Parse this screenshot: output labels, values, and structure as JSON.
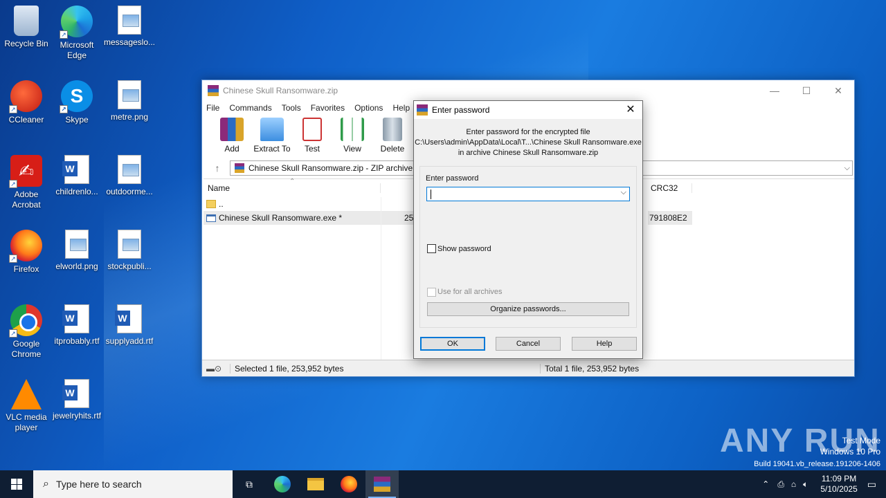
{
  "desktop": {
    "icons": [
      {
        "label": "Recycle Bin"
      },
      {
        "label": "Microsoft Edge"
      },
      {
        "label": "messageslo..."
      },
      {
        "label": "CCleaner"
      },
      {
        "label": "Skype"
      },
      {
        "label": "metre.png"
      },
      {
        "label": "Adobe Acrobat"
      },
      {
        "label": "childrenlo..."
      },
      {
        "label": "outdoorme..."
      },
      {
        "label": "Firefox"
      },
      {
        "label": "elworld.png"
      },
      {
        "label": "stockpubli..."
      },
      {
        "label": "Google Chrome"
      },
      {
        "label": "itprobably.rtf"
      },
      {
        "label": "supplyadd.rtf"
      },
      {
        "label": "VLC media player"
      },
      {
        "label": "jewelryhits.rtf"
      }
    ]
  },
  "winrar": {
    "title": "Chinese Skull Ransomware.zip",
    "menu": [
      "File",
      "Commands",
      "Tools",
      "Favorites",
      "Options",
      "Help"
    ],
    "toolbar": [
      "Add",
      "Extract To",
      "Test",
      "View",
      "Delete"
    ],
    "address": "Chinese Skull Ransomware.zip - ZIP archive",
    "columns": {
      "name": "Name",
      "crc": "CRC32"
    },
    "rows": [
      {
        "name": "..",
        "size": "",
        "crc": ""
      },
      {
        "name": "Chinese Skull Ransomware.exe *",
        "size": "25",
        "crc": "791808E2"
      }
    ],
    "status_left": "Selected 1 file, 253,952 bytes",
    "status_right": "Total 1 file, 253,952 bytes"
  },
  "dialog": {
    "title": "Enter password",
    "message_line1": "Enter password for the encrypted file",
    "message_line2": "C:\\Users\\admin\\AppData\\Local\\T...\\Chinese Skull Ransomware.exe",
    "message_line3": "in archive Chinese Skull Ransomware.zip",
    "password_label": "Enter password",
    "password_value": "",
    "show_password_label": "Show password",
    "use_all_label": "Use for all archives",
    "organize_label": "Organize passwords...",
    "ok": "OK",
    "cancel": "Cancel",
    "help": "Help"
  },
  "watermark": {
    "brand": "ANY RUN",
    "line1": "Test Mode",
    "line2": "Windows 10 Pro",
    "line3": "Build 19041.vb_release.191206-1406"
  },
  "taskbar": {
    "search_placeholder": "Type here to search",
    "time": "11:09 PM",
    "date": "5/10/2025"
  }
}
